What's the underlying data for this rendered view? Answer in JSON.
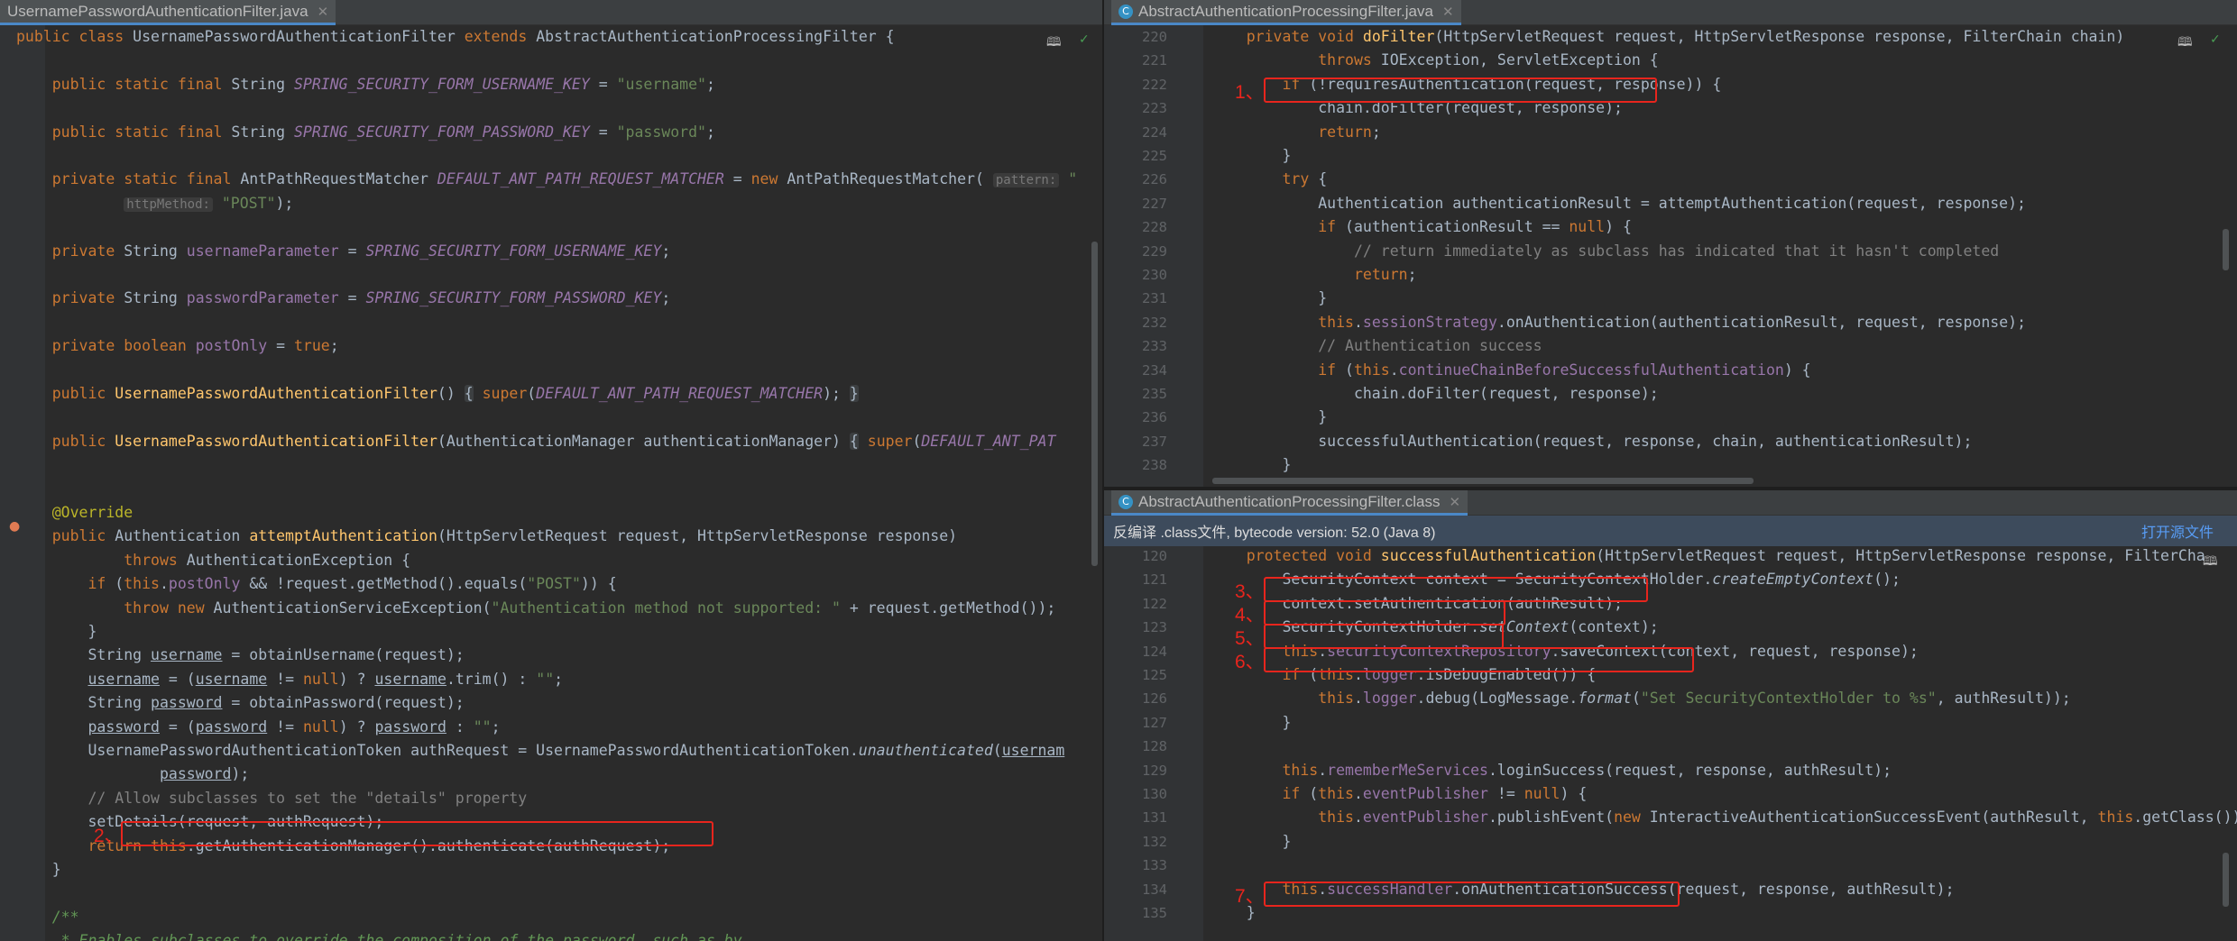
{
  "left": {
    "tab": "UsernamePasswordAuthenticationFilter.java",
    "lines": [
      "<span class=\"kw\">public class</span> UsernamePasswordAuthenticationFilter <span class=\"kw\">extends</span> AbstractAuthenticationProcessingFilter {",
      "",
      "    <span class=\"kw\">public static final</span> String <span class=\"cn\">SPRING_SECURITY_FORM_USERNAME_KEY</span> = <span class=\"st\">\"username\"</span>;",
      "",
      "    <span class=\"kw\">public static final</span> String <span class=\"cn\">SPRING_SECURITY_FORM_PASSWORD_KEY</span> = <span class=\"st\">\"password\"</span>;",
      "",
      "    <span class=\"kw\">private static final</span> AntPathRequestMatcher <span class=\"cn\">DEFAULT_ANT_PATH_REQUEST_MATCHER</span> = <span class=\"kw\">new</span> AntPathRequestMatcher( <span class=\"hint\">pattern:</span> <span class=\"st\">\"</span>",
      "            <span class=\"hint\">httpMethod:</span> <span class=\"st\">\"POST\"</span>);",
      "",
      "    <span class=\"kw\">private</span> String <span class=\"fd\">usernameParameter</span> = <span class=\"cn\">SPRING_SECURITY_FORM_USERNAME_KEY</span>;",
      "",
      "    <span class=\"kw\">private</span> String <span class=\"fd\">passwordParameter</span> = <span class=\"cn\">SPRING_SECURITY_FORM_PASSWORD_KEY</span>;",
      "",
      "    <span class=\"kw\">private boolean</span> <span class=\"fd\">postOnly</span> = <span class=\"kw\">true</span>;",
      "",
      "    <span class=\"kw\">public</span> <span class=\"fn\">UsernamePasswordAuthenticationFilter</span>() <span class=\"fold\">{</span> <span class=\"kw\">super</span>(<span class=\"cn\">DEFAULT_ANT_PATH_REQUEST_MATCHER</span>); <span class=\"fold\">}</span>",
      "",
      "    <span class=\"kw\">public</span> <span class=\"fn\">UsernamePasswordAuthenticationFilter</span>(AuthenticationManager authenticationManager) <span class=\"fold\">{</span> <span class=\"kw\">super</span>(<span class=\"cn\">DEFAULT_ANT_PAT</span>",
      "",
      "",
      "    <span class=\"an\">@Override</span>",
      "    <span class=\"kw\">public</span> Authentication <span class=\"fn\">attemptAuthentication</span>(HttpServletRequest request, HttpServletResponse response)",
      "            <span class=\"kw\">throws</span> AuthenticationException {",
      "        <span class=\"kw\">if</span> (<span class=\"kw\">this</span>.<span class=\"fd\">postOnly</span> &amp;&amp; !request.getMethod().equals(<span class=\"st\">\"POST\"</span>)) {",
      "            <span class=\"kw\">throw new</span> AuthenticationServiceException(<span class=\"st\">\"Authentication method not supported: \"</span> + request.getMethod());",
      "        }",
      "        String <span class=\"ul\">username</span> = obtainUsername(request);",
      "        <span class=\"ul\">username</span> = (<span class=\"ul\">username</span> != <span class=\"kw\">null</span>) ? <span class=\"ul\">username</span>.trim() : <span class=\"st\">\"\"</span>;",
      "        String <span class=\"ul\">password</span> = obtainPassword(request);",
      "        <span class=\"ul\">password</span> = (<span class=\"ul\">password</span> != <span class=\"kw\">null</span>) ? <span class=\"ul\">password</span> : <span class=\"st\">\"\"</span>;",
      "        UsernamePasswordAuthenticationToken authRequest = UsernamePasswordAuthenticationToken.<span class=\"it\">unauthenticated</span>(<span class=\"ul\">usernam</span>",
      "                <span class=\"ul\">password</span>);",
      "        <span class=\"cm\">// Allow subclasses to set the \"details\" property</span>",
      "        setDetails(request, authRequest);",
      "        <span class=\"kw\">return this</span>.getAuthenticationManager().authenticate(authRequest);",
      "    }",
      "",
      "    <span class=\"doc\">/**</span>",
      "    <span class=\"doc\"> * Enables subclasses to override the composition of the password, such as by</span>"
    ]
  },
  "right_top": {
    "tab": "AbstractAuthenticationProcessingFilter.java",
    "line_numbers": [
      "220",
      "221",
      "222",
      "223",
      "224",
      "225",
      "226",
      "227",
      "228",
      "229",
      "230",
      "231",
      "232",
      "233",
      "234",
      "235",
      "236",
      "237",
      "238"
    ],
    "lines": [
      "    <span class=\"kw\">private void</span> <span class=\"fn\">doFilter</span>(HttpServletRequest request, HttpServletResponse response, FilterChain chain)",
      "            <span class=\"kw\">throws</span> IOException, ServletException {",
      "        <span class=\"kw\">if</span> (!requiresAuthentication(request, response)) {",
      "            chain.doFilter(request, response);",
      "            <span class=\"kw\">return</span>;",
      "        }",
      "        <span class=\"kw\">try</span> {",
      "            Authentication authenticationResult = attemptAuthentication(request, response);",
      "            <span class=\"kw\">if</span> (authenticationResult == <span class=\"kw\">null</span>) {",
      "                <span class=\"cm\">// return immediately as subclass has indicated that it hasn't completed</span>",
      "                <span class=\"kw\">return</span>;",
      "            }",
      "            <span class=\"kw\">this</span>.<span class=\"fd\">sessionStrategy</span>.onAuthentication(authenticationResult, request, response);",
      "            <span class=\"cm\">// Authentication success</span>",
      "            <span class=\"kw\">if</span> (<span class=\"kw\">this</span>.<span class=\"fd\">continueChainBeforeSuccessfulAuthentication</span>) {",
      "                chain.doFilter(request, response);",
      "            }",
      "            successfulAuthentication(request, response, chain, authenticationResult);",
      "        }"
    ]
  },
  "right_bottom": {
    "tab": "AbstractAuthenticationProcessingFilter.class",
    "banner": "反编译 .class文件, bytecode version: 52.0 (Java 8)",
    "banner_link": "打开源文件",
    "line_numbers": [
      "120",
      "121",
      "122",
      "123",
      "124",
      "125",
      "126",
      "127",
      "128",
      "129",
      "130",
      "131",
      "132",
      "133",
      "134",
      "135"
    ],
    "lines": [
      "    <span class=\"kw\">protected void</span> <span class=\"fn\">successfulAuthentication</span>(HttpServletRequest request, HttpServletResponse response, FilterCha",
      "        SecurityContext context = SecurityContextHolder.<span class=\"it\">createEmptyContext</span>();",
      "        context.setAuthentication(authResult);",
      "        SecurityContextHolder.<span class=\"it\">setContext</span>(context);",
      "        <span class=\"kw\">this</span>.<span class=\"fd\">securityContextRepository</span>.saveContext(context, request, response);",
      "        <span class=\"kw\">if</span> (<span class=\"kw\">this</span>.<span class=\"fd\">logger</span>.isDebugEnabled()) {",
      "            <span class=\"kw\">this</span>.<span class=\"fd\">logger</span>.debug(LogMessage.<span class=\"it\">format</span>(<span class=\"st\">\"Set SecurityContextHolder to %s\"</span>, authResult));",
      "        }",
      "",
      "        <span class=\"kw\">this</span>.<span class=\"fd\">rememberMeServices</span>.loginSuccess(request, response, authResult);",
      "        <span class=\"kw\">if</span> (<span class=\"kw\">this</span>.<span class=\"fd\">eventPublisher</span> != <span class=\"kw\">null</span>) {",
      "            <span class=\"kw\">this</span>.<span class=\"fd\">eventPublisher</span>.publishEvent(<span class=\"kw\">new</span> InteractiveAuthenticationSuccessEvent(authResult, <span class=\"kw\">this</span>.getClass()));",
      "        }",
      "",
      "        <span class=\"kw\">this</span>.<span class=\"fd\">successHandler</span>.onAuthenticationSuccess(request, response, authResult);",
      "    }"
    ]
  },
  "annotations": [
    "1、",
    "2、",
    "3、",
    "4、",
    "5、",
    "6、",
    "7、"
  ],
  "icons": {
    "reader_mode": "book-icon",
    "check": "check-icon",
    "class_file": "class-icon"
  },
  "colors": {
    "keyword": "#cc7832",
    "string": "#6a8759",
    "method": "#ffc66d",
    "field": "#9876aa",
    "comment": "#808080",
    "highlight_box": "#e8251d"
  }
}
